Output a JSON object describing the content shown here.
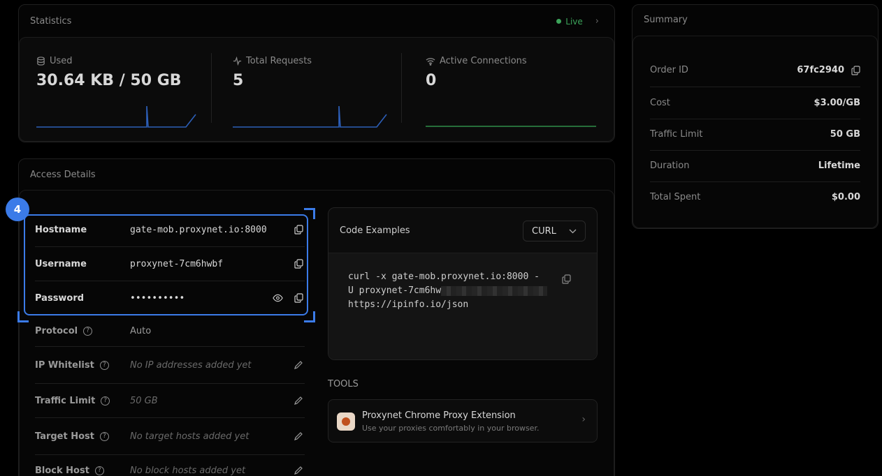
{
  "statistics": {
    "title": "Statistics",
    "live_label": "Live",
    "used": {
      "label": "Used",
      "value": "30.64 KB / 50 GB"
    },
    "total_requests": {
      "label": "Total Requests",
      "value": "5"
    },
    "active_connections": {
      "label": "Active Connections",
      "value": "0"
    }
  },
  "summary": {
    "title": "Summary",
    "rows": [
      {
        "label": "Order ID",
        "value": "67fc2940"
      },
      {
        "label": "Cost",
        "value": "$3.00/GB"
      },
      {
        "label": "Traffic Limit",
        "value": "50 GB"
      },
      {
        "label": "Duration",
        "value": "Lifetime"
      },
      {
        "label": "Total Spent",
        "value": "$0.00"
      }
    ]
  },
  "access": {
    "title": "Access Details",
    "step_badge": "4",
    "hostname": {
      "label": "Hostname",
      "value": "gate-mob.proxynet.io:8000"
    },
    "username": {
      "label": "Username",
      "value": "proxynet-7cm6hwbf"
    },
    "password": {
      "label": "Password",
      "value": "••••••••••"
    },
    "protocol": {
      "label": "Protocol",
      "value": "Auto"
    },
    "ip_whitelist": {
      "label": "IP Whitelist",
      "value": "No IP addresses added yet"
    },
    "traffic_limit": {
      "label": "Traffic Limit",
      "value": "50 GB"
    },
    "target_host": {
      "label": "Target Host",
      "value": "No target hosts added yet"
    },
    "block_host": {
      "label": "Block Host",
      "value": "No block hosts added yet"
    }
  },
  "code_examples": {
    "title": "Code Examples",
    "language": "CURL",
    "line1": "curl -x gate-mob.proxynet.io:8000 -",
    "line2": "U proxynet-7cm6hw",
    "line3": "https://ipinfo.io/json"
  },
  "tools": {
    "title": "TOOLS",
    "item_title": "Proxynet Chrome Proxy Extension",
    "item_subtitle": "Use your proxies comfortably in your browser."
  },
  "colors": {
    "accent": "#3b7be8",
    "live": "#3ca45a",
    "chart_blue": "#2d5fb8",
    "chart_green": "#2f8f4a"
  }
}
